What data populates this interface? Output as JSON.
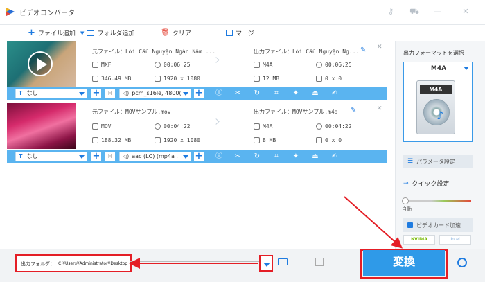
{
  "window": {
    "title": "ビデオコンバータ"
  },
  "toolbar": {
    "add_file": "ファイル追加",
    "add_folder": "フォルダ追加",
    "clear": "クリア",
    "merge": "マージ"
  },
  "files": [
    {
      "source_label": "元ファイル：",
      "source_name": "Lời Cầu Nguyện Ngàn Năm ...",
      "source_format": "MXF",
      "source_duration": "00:06:25",
      "source_size": "346.49 MB",
      "source_resolution": "1920 x 1080",
      "output_label": "出力ファイル：",
      "output_name": "Lời Cầu Nguyện Ng...",
      "output_format": "M4A",
      "output_duration": "00:06:25",
      "output_size": "12 MB",
      "output_resolution": "0 x 0",
      "subtitle": "なし",
      "audio": "pcm_s16le, 4800("
    },
    {
      "source_label": "元ファイル：",
      "source_name": "MOVサンプル.mov",
      "source_format": "MOV",
      "source_duration": "00:04:22",
      "source_size": "188.32 MB",
      "source_resolution": "1920 x 1080",
      "output_label": "出力ファイル：",
      "output_name": "MOVサンプル.m4a",
      "output_format": "M4A",
      "output_duration": "00:04:22",
      "output_size": "8 MB",
      "output_resolution": "0 x 0",
      "subtitle": "なし",
      "audio": "aac (LC) (mp4a ."
    }
  ],
  "sidebar": {
    "select_format_label": "出力フォーマットを選択",
    "format_name": "M4A",
    "format_icon_text": "M4A",
    "param_settings": "パラメータ設定",
    "quick_settings": "クイック設定",
    "slider_label": "自動",
    "gpu_accel": "ビデオカード加速",
    "nvidia": "NVIDIA",
    "intel": "Intel"
  },
  "bottom": {
    "output_folder_label": "出力フォルダ：",
    "output_folder_path": "C:¥Users¥Administrator¥Desktop",
    "convert": "変換"
  },
  "colors": {
    "accent": "#2f9ae8",
    "bar": "#5ab4f0",
    "annotation_red": "#e41e26"
  }
}
